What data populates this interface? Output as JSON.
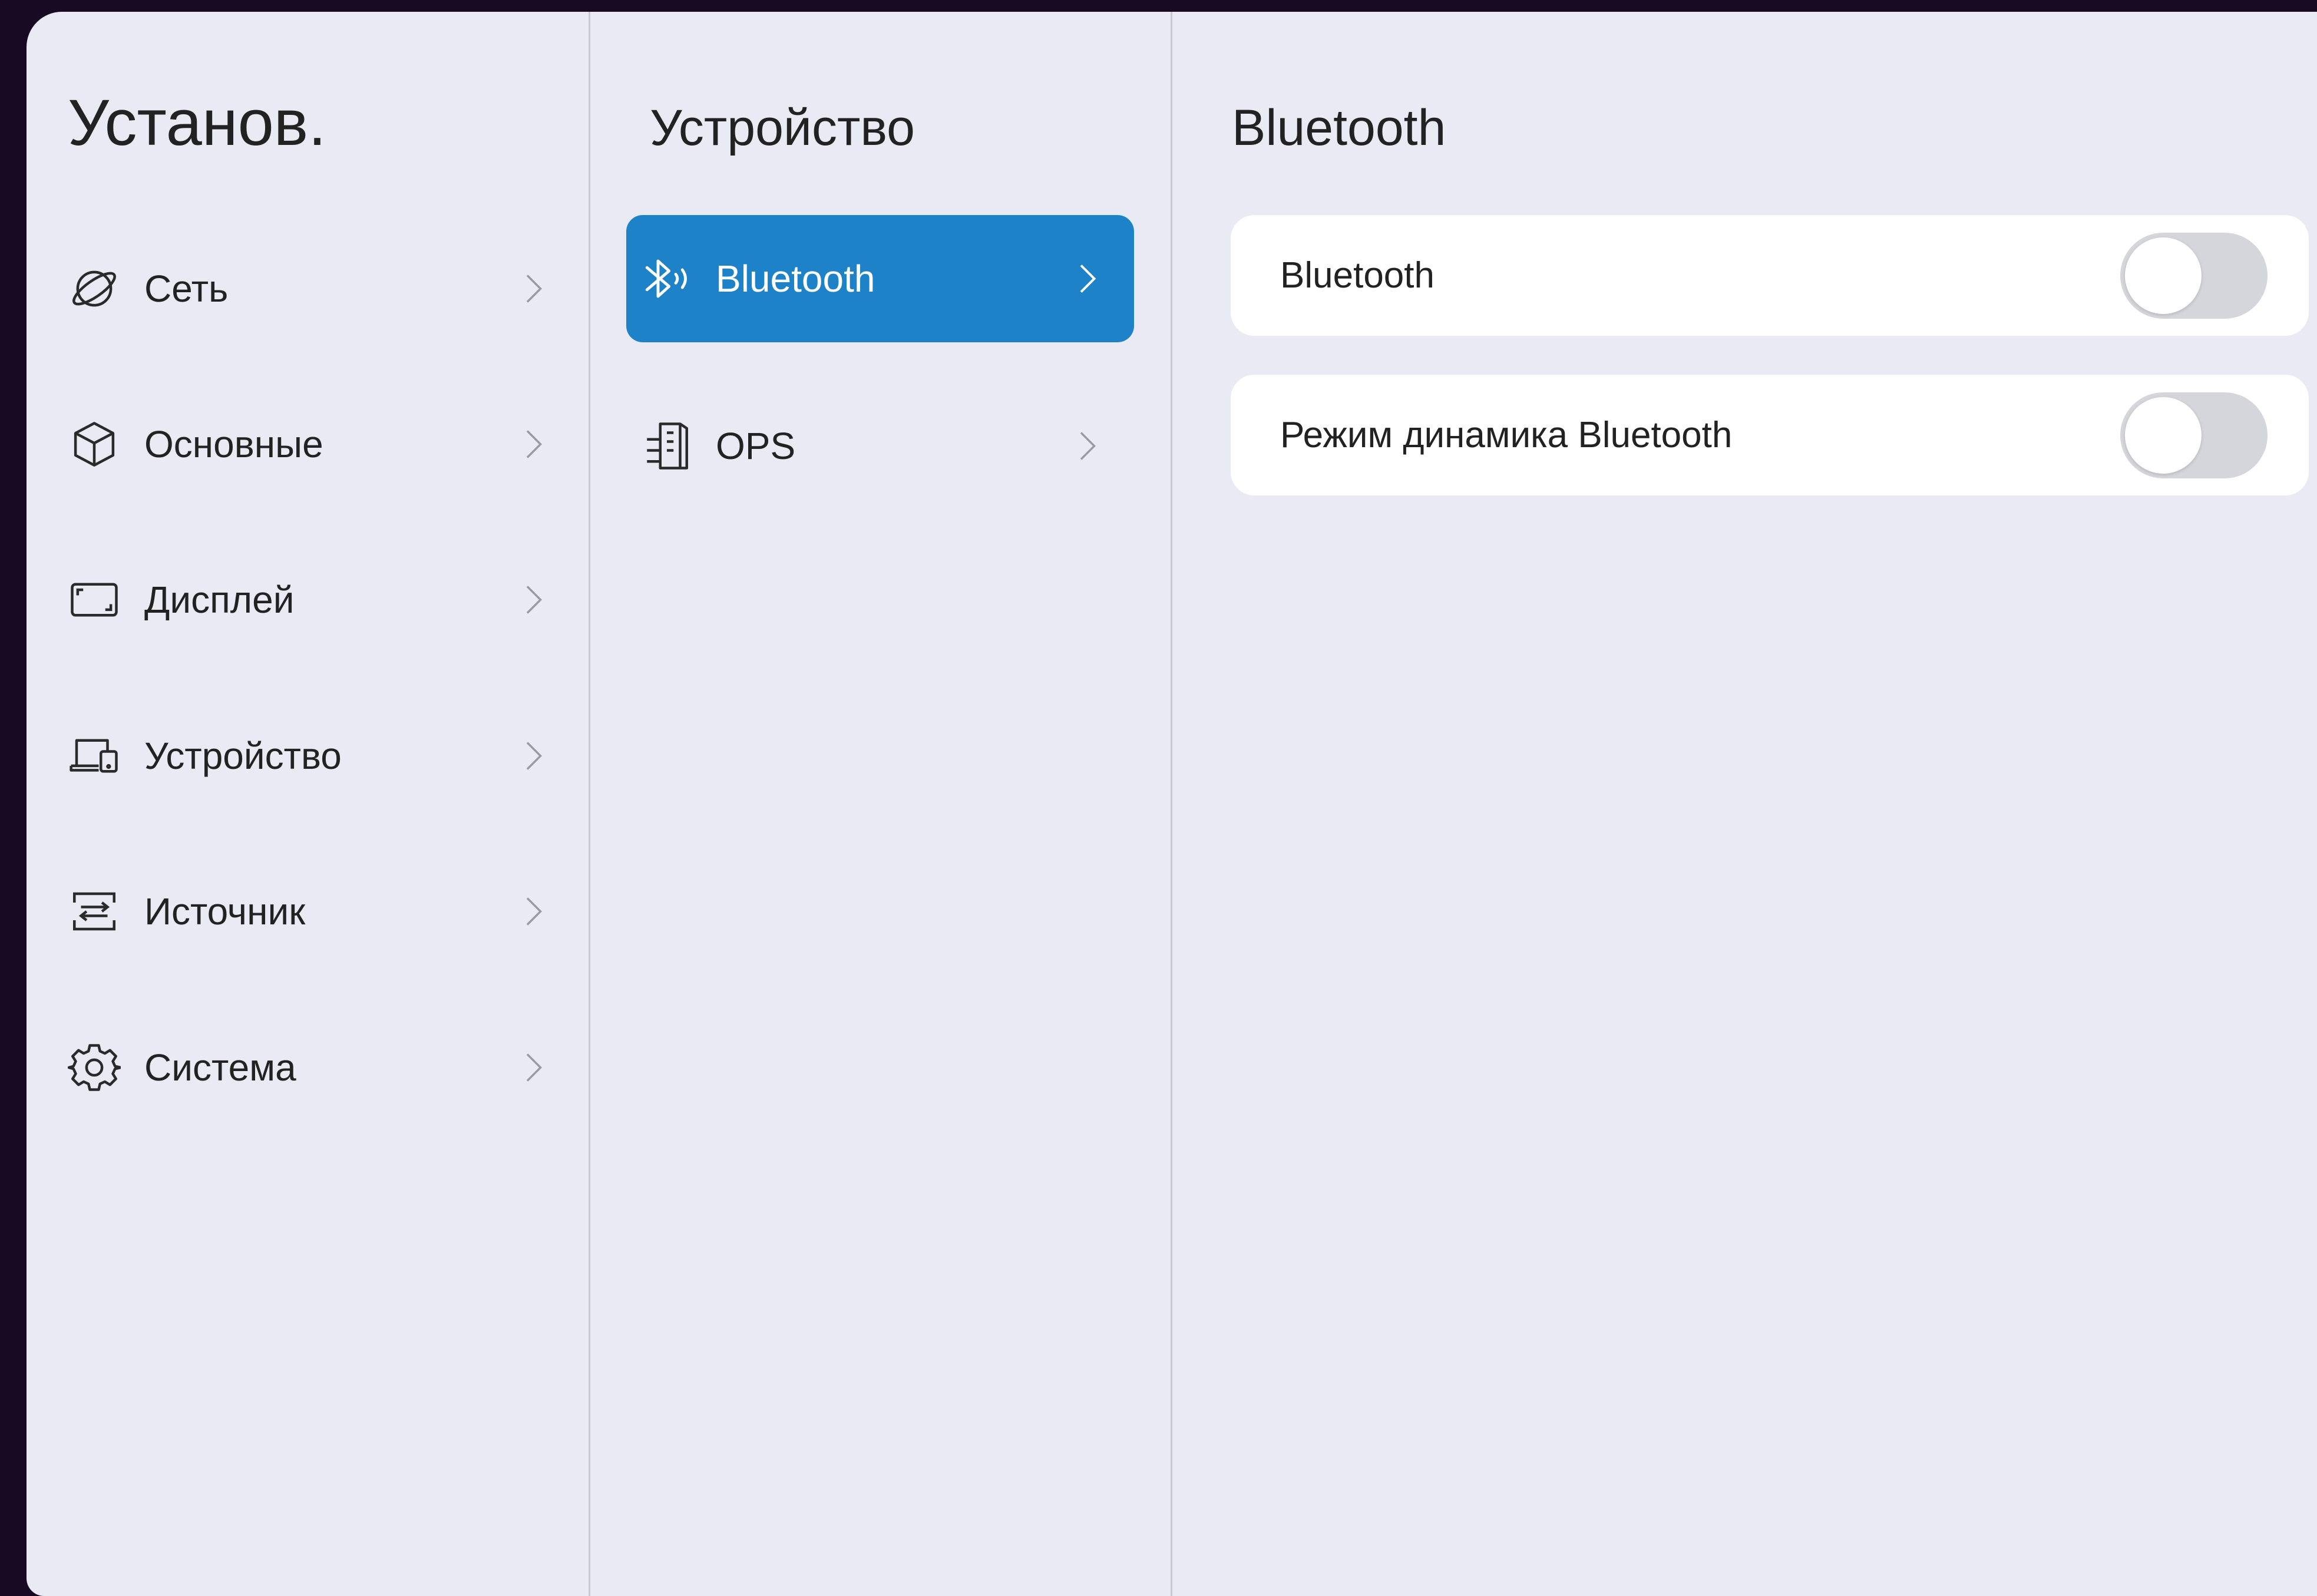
{
  "settings_menu": {
    "title": "Установ.",
    "items": [
      {
        "label": "Сеть",
        "icon": "globe-icon"
      },
      {
        "label": "Основные",
        "icon": "cube-icon"
      },
      {
        "label": "Дисплей",
        "icon": "display-icon"
      },
      {
        "label": "Устройство",
        "icon": "device-icon"
      },
      {
        "label": "Источник",
        "icon": "source-icon"
      },
      {
        "label": "Система",
        "icon": "gear-icon"
      }
    ]
  },
  "device_menu": {
    "title": "Устройство",
    "items": [
      {
        "label": "Bluetooth",
        "icon": "bluetooth-icon",
        "selected": true
      },
      {
        "label": "OPS",
        "icon": "ops-icon",
        "selected": false
      }
    ]
  },
  "bluetooth_panel": {
    "title": "Bluetooth",
    "options": [
      {
        "label": "Bluetooth",
        "enabled": false
      },
      {
        "label": "Режим динамика Bluetooth",
        "enabled": false
      }
    ]
  },
  "colors": {
    "accent": "#1e82c8",
    "background": "#e9eaf4",
    "card": "#ffffff",
    "toggle_off": "#d5d6dc"
  }
}
